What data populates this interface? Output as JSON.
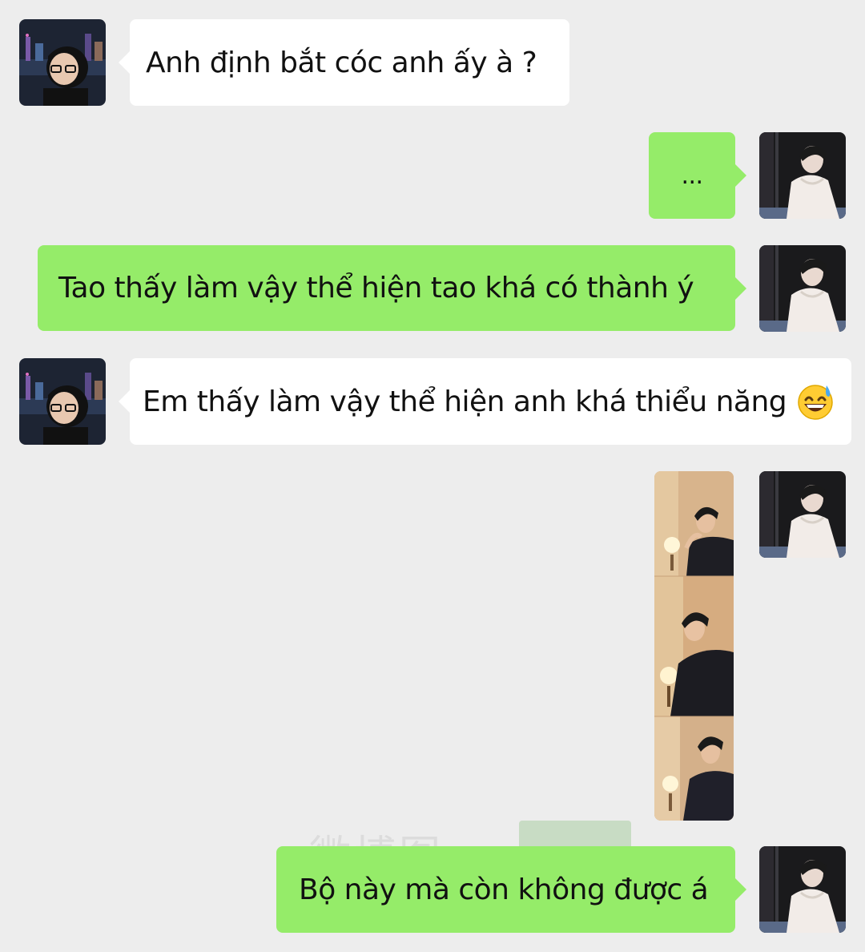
{
  "messages": [
    {
      "sender": "other",
      "text": "Anh định bắt cóc anh ấy à ?"
    },
    {
      "sender": "me",
      "text": "..."
    },
    {
      "sender": "me",
      "text": "Tao thấy làm vậy thể hiện tao khá có thành ý"
    },
    {
      "sender": "other",
      "text": "Em thấy làm vậy thể hiện anh khá thiểu năng",
      "emoji": "grinning-sweat-emoji"
    },
    {
      "sender": "me",
      "image": "photo-strip"
    },
    {
      "sender": "me",
      "text": "Bộ này mà còn không được á"
    }
  ],
  "watermark": {
    "text": "微博图"
  },
  "colors": {
    "background": "#ededed",
    "incoming_bubble": "#ffffff",
    "outgoing_bubble": "#95ec69"
  }
}
